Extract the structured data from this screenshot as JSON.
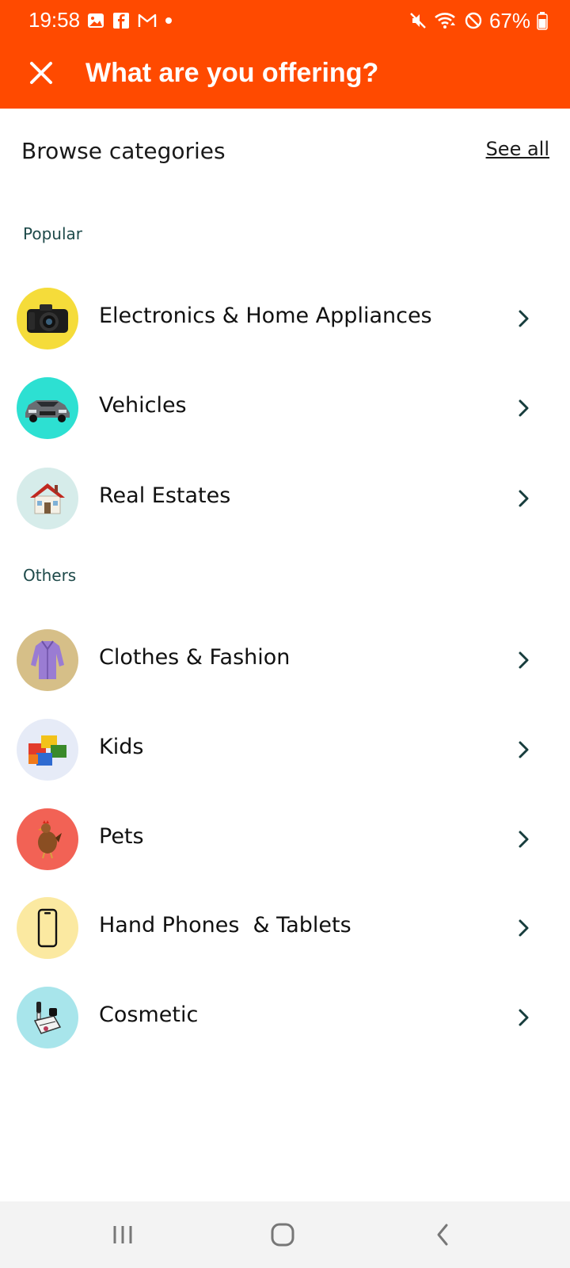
{
  "status_bar": {
    "time": "19:58",
    "battery": "67%",
    "left_icons": [
      "gallery-icon",
      "facebook-icon",
      "gmail-icon",
      "dot-icon"
    ],
    "right_icons": [
      "mute-icon",
      "wifi-icon",
      "dnd-icon",
      "battery-icon"
    ]
  },
  "header": {
    "title": "What are you offering?",
    "close_icon": "close-icon",
    "background": "#ff4a00"
  },
  "browse": {
    "title": "Browse categories",
    "see_all": "See all"
  },
  "sections": {
    "popular": "Popular",
    "others": "Others"
  },
  "popular_items": [
    {
      "label": "Electronics & Home Appliances",
      "icon": "camera-icon",
      "color": "#f5dc3a"
    },
    {
      "label": "Vehicles",
      "icon": "car-icon",
      "color": "#2de0d2"
    },
    {
      "label": "Real Estates",
      "icon": "house-icon",
      "color": "#d6ecea"
    }
  ],
  "other_items": [
    {
      "label": "Clothes & Fashion",
      "icon": "coat-icon",
      "color": "#d6bf88"
    },
    {
      "label": "Kids",
      "icon": "toy-blocks-icon",
      "color": "#e6ebf7"
    },
    {
      "label": "Pets",
      "icon": "chicken-icon",
      "color": "#f26255"
    },
    {
      "label": "Hand Phones  & Tablets",
      "icon": "phone-icon",
      "color": "#fbe9a1"
    },
    {
      "label": "Cosmetic",
      "icon": "cosmetics-icon",
      "color": "#a8e5eb"
    }
  ],
  "nav": {
    "icons": [
      "recent-apps-icon",
      "home-icon",
      "back-icon"
    ]
  }
}
